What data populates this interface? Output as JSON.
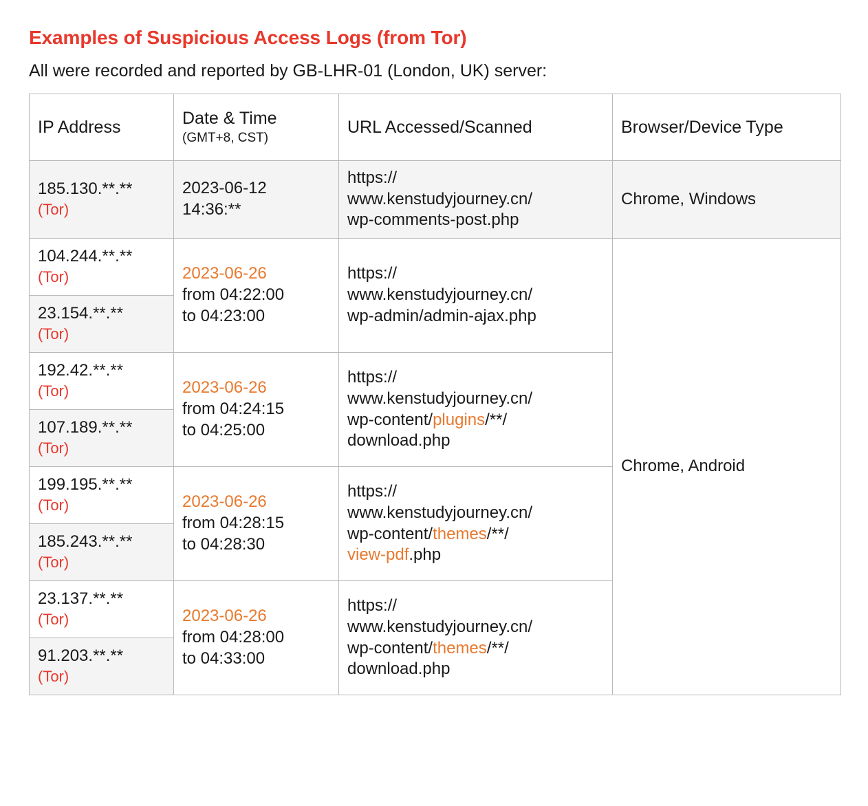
{
  "document": {
    "title": "Examples of Suspicious Access Logs (from Tor)",
    "subtitle": "All were recorded and reported by GB-LHR-01 (London, UK) server:"
  },
  "colors": {
    "title_red": "#e8382c",
    "tor_red": "#e8382c",
    "highlight_orange": "#e8792e",
    "row_shade": "#f4f4f4",
    "border": "#b9b9b9"
  },
  "table": {
    "headers": {
      "ip": "IP Address",
      "datetime_main": "Date & Time",
      "datetime_sub": "(GMT+8, CST)",
      "url": "URL Accessed/Scanned",
      "device": "Browser/Device Type"
    },
    "tor_tag": "(Tor)",
    "groups": [
      {
        "ips": [
          "185.130.**.**"
        ],
        "datetime": {
          "date": "2023-06-12",
          "date_highlighted": false,
          "lines": [
            "14:36:**"
          ]
        },
        "url_lines": [
          [
            {
              "t": "https://",
              "hl": false
            }
          ],
          [
            {
              "t": "www.kenstudyjourney.cn/",
              "hl": false
            }
          ],
          [
            {
              "t": "wp-comments-post.php",
              "hl": false
            }
          ]
        ],
        "device": "Chrome, Windows"
      },
      {
        "ips": [
          "104.244.**.**",
          "23.154.**.**"
        ],
        "datetime": {
          "date": "2023-06-26",
          "date_highlighted": true,
          "lines": [
            "from 04:22:00",
            "to 04:23:00"
          ]
        },
        "url_lines": [
          [
            {
              "t": "https://",
              "hl": false
            }
          ],
          [
            {
              "t": "www.kenstudyjourney.cn/",
              "hl": false
            }
          ],
          [
            {
              "t": "wp-admin/admin-ajax.php",
              "hl": false
            }
          ]
        ],
        "device": "Chrome, Android"
      },
      {
        "ips": [
          "192.42.**.**",
          "107.189.**.**"
        ],
        "datetime": {
          "date": "2023-06-26",
          "date_highlighted": true,
          "lines": [
            "from 04:24:15",
            "to 04:25:00"
          ]
        },
        "url_lines": [
          [
            {
              "t": "https://",
              "hl": false
            }
          ],
          [
            {
              "t": "www.kenstudyjourney.cn/",
              "hl": false
            }
          ],
          [
            {
              "t": "wp-content/",
              "hl": false
            },
            {
              "t": "plugins",
              "hl": true
            },
            {
              "t": "/**/",
              "hl": false
            }
          ],
          [
            {
              "t": "download.php",
              "hl": false
            }
          ]
        ],
        "device": ""
      },
      {
        "ips": [
          "199.195.**.**",
          "185.243.**.**"
        ],
        "datetime": {
          "date": "2023-06-26",
          "date_highlighted": true,
          "lines": [
            "from 04:28:15",
            "to 04:28:30"
          ]
        },
        "url_lines": [
          [
            {
              "t": "https://",
              "hl": false
            }
          ],
          [
            {
              "t": "www.kenstudyjourney.cn/",
              "hl": false
            }
          ],
          [
            {
              "t": "wp-content/",
              "hl": false
            },
            {
              "t": "themes",
              "hl": true
            },
            {
              "t": "/**/",
              "hl": false
            }
          ],
          [
            {
              "t": "view-pdf",
              "hl": true
            },
            {
              "t": ".php",
              "hl": false
            }
          ]
        ],
        "device": ""
      },
      {
        "ips": [
          "23.137.**.**",
          "91.203.**.**"
        ],
        "datetime": {
          "date": "2023-06-26",
          "date_highlighted": true,
          "lines": [
            "from 04:28:00",
            "to 04:33:00"
          ]
        },
        "url_lines": [
          [
            {
              "t": "https://",
              "hl": false
            }
          ],
          [
            {
              "t": "www.kenstudyjourney.cn/",
              "hl": false
            }
          ],
          [
            {
              "t": "wp-content/",
              "hl": false
            },
            {
              "t": "themes",
              "hl": true
            },
            {
              "t": "/**/",
              "hl": false
            }
          ],
          [
            {
              "t": "download.php",
              "hl": false
            }
          ]
        ],
        "device": ""
      }
    ]
  }
}
